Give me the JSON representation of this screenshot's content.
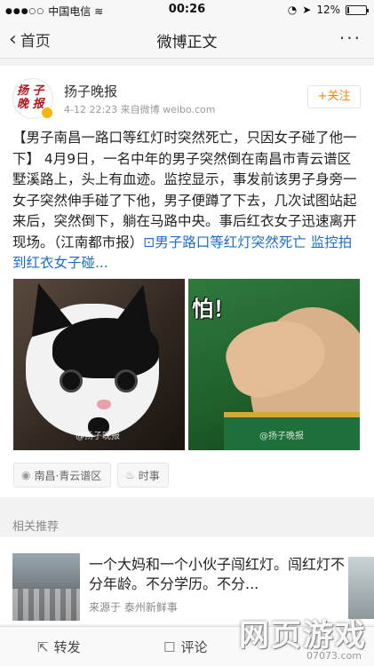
{
  "status_bar": {
    "carrier": "中国电信",
    "time": "00:26",
    "battery_text": "12%",
    "battery_level": 0.12
  },
  "nav": {
    "back_label": "首页",
    "title": "微博正文",
    "more_icon": "ellipsis-icon"
  },
  "post": {
    "author": "扬子晚报",
    "avatar_text": "扬子晚报",
    "meta": "4-12 22:23  来自微博 weibo.com",
    "follow_label": "+关注",
    "text": "【男子南昌一路口等红灯时突然死亡，只因女子碰了他一下】 4月9日，一名中年的男子突然倒在南昌市青云谱区墅溪路上，头上有血迹。监控显示，事发前该男子身旁一女子突然伸手碰了下他，男子便蹲了下去，几次试图站起来后，突然倒下，躺在马路中央。事后红衣女子迅速离开现场。（江南都市报）",
    "link_text": "男子路口等红灯突然死亡 监控拍到红衣女子碰...",
    "link_icon": "web-link-icon",
    "images": [
      {
        "alt": "cat-surprised-photo",
        "watermark": "@扬子晚报"
      },
      {
        "alt": "boy-afraid-meme",
        "caption": "怕！",
        "watermark": "@扬子晚报"
      }
    ],
    "tags": [
      {
        "label": "南昌·青云谱区",
        "icon": "location-icon"
      },
      {
        "label": "时事",
        "icon": "flame-icon"
      }
    ]
  },
  "recommend": {
    "header": "相关推荐",
    "item": {
      "title": "一个大妈和一个小伙子闯红灯。闯红灯不分年龄。不分学历。不分...",
      "source": "来源于  泰州新鲜事"
    }
  },
  "toolbar": {
    "repost_label": "转发",
    "comment_label": "评论"
  },
  "watermark": {
    "text": "网页游戏",
    "url": "07073.com"
  },
  "colors": {
    "accent_orange": "#ff8200",
    "link_blue": "#1d6ec5",
    "brand_red": "#b4141e"
  }
}
